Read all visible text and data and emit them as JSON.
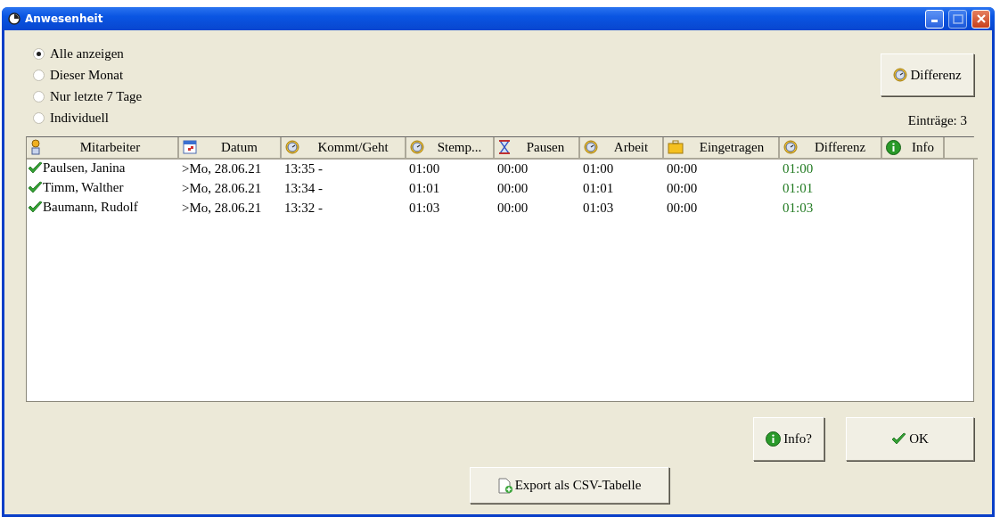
{
  "window": {
    "title": "Anwesenheit"
  },
  "filters": [
    {
      "label": "Alle anzeigen",
      "selected": true
    },
    {
      "label": "Dieser Monat",
      "selected": false
    },
    {
      "label": "Nur letzte 7 Tage",
      "selected": false
    },
    {
      "label": "Individuell",
      "selected": false
    }
  ],
  "difference_button": "Differenz",
  "entry_count": "Einträge: 3",
  "table": {
    "columns": [
      "Mitarbeiter",
      "Datum",
      "Kommt/Geht",
      "Stemp...",
      "Pausen",
      "Arbeit",
      "Eingetragen",
      "Differenz",
      "Info"
    ],
    "rows": [
      {
        "checked": true,
        "cells": [
          "Paulsen, Janina",
          ">Mo, 28.06.21",
          "13:35 -",
          "01:00",
          "00:00",
          "01:00",
          "00:00",
          "01:00"
        ]
      },
      {
        "checked": true,
        "cells": [
          "Timm, Walther",
          ">Mo, 28.06.21",
          "13:34 -",
          "01:01",
          "00:00",
          "01:01",
          "00:00",
          "01:01"
        ]
      },
      {
        "checked": true,
        "cells": [
          "Baumann, Rudolf",
          ">Mo, 28.06.21",
          "13:32 -",
          "01:03",
          "00:00",
          "01:03",
          "00:00",
          "01:03"
        ]
      }
    ]
  },
  "buttons": {
    "info": "Info?",
    "ok": "OK",
    "export": "Export als CSV-Tabelle"
  }
}
